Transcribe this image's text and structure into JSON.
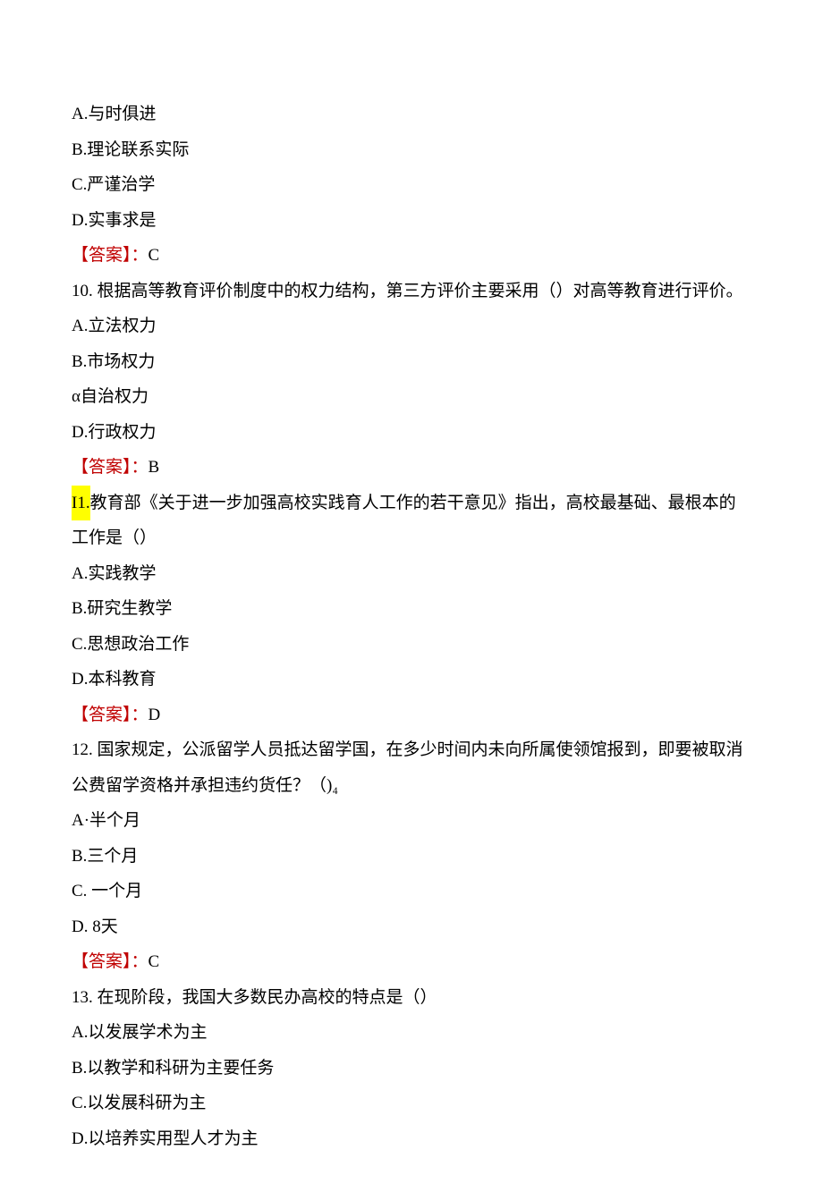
{
  "q9": {
    "optA": "A.与时俱进",
    "optB": "B.理论联系实际",
    "optC": "C.严谨治学",
    "optD": "D.实事求是",
    "answerLabel": "【答案】：",
    "answerValue": "C"
  },
  "q10": {
    "stem": "10. 根据高等教育评价制度中的权力结构，第三方评价主要采用（）对高等教育进行评价。",
    "optA": "A.立法权力",
    "optB": "B.市场权力",
    "optC": "α自治权力",
    "optD": "D.行政权力",
    "answerLabel": "【答案】：",
    "answerValue": "B"
  },
  "q11": {
    "prefixHighlight": "I1.",
    "stemRest": "教育部《关于进一步加强高校实践育人工作的若干意见》指出，高校最基础、最根本的工作是（）",
    "optA": "A.实践教学",
    "optB": "B.研究生教学",
    "optC": "C.思想政治工作",
    "optD": "D.本科教育",
    "answerLabel": "【答案】：",
    "answerValue": "D"
  },
  "q12": {
    "stem": "12. 国家规定，公派留学人员抵达留学国，在多少时间内未向所属使领馆报到，即要被取消公费留学资格并承担违约货任？（)₄",
    "optA": "A·半个月",
    "optB": "B.三个月",
    "optC": "C. 一个月",
    "optD": "D. 8天",
    "answerLabel": "【答案】：",
    "answerValue": "C"
  },
  "q13": {
    "stem": "13. 在现阶段，我国大多数民办高校的特点是（）",
    "optA": "A.以发展学术为主",
    "optB": "B.以教学和科研为主要任务",
    "optC": "C.以发展科研为主",
    "optD": "D.以培养实用型人才为主"
  }
}
